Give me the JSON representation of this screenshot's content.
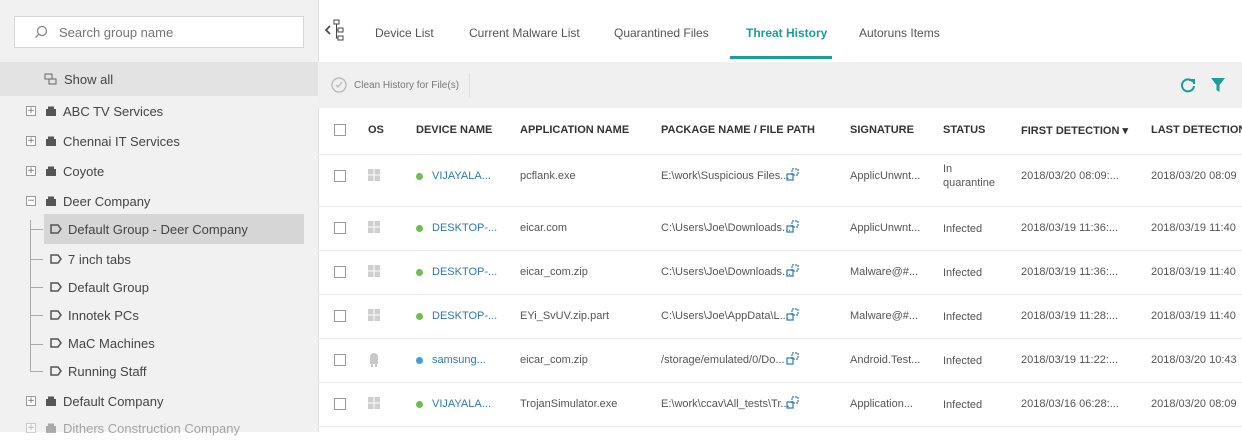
{
  "sidebar": {
    "search_placeholder": "Search group name",
    "show_all_label": "Show all",
    "groups": [
      {
        "label": "ABC TV Services",
        "expander": "+"
      },
      {
        "label": "Chennai IT Services",
        "expander": "+"
      },
      {
        "label": "Coyote",
        "expander": "+"
      },
      {
        "label": "Deer Company",
        "expander": "−"
      },
      {
        "label": "Default Company",
        "expander": "+"
      },
      {
        "label": "Dithers Construction Company",
        "expander": "+"
      }
    ],
    "subgroups": [
      {
        "label": "Default Group - Deer Company",
        "selected": true
      },
      {
        "label": "7 inch tabs"
      },
      {
        "label": "Default Group"
      },
      {
        "label": "Innotek PCs"
      },
      {
        "label": "MaC Machines"
      },
      {
        "label": "Running Staff"
      }
    ]
  },
  "tabs": [
    {
      "label": "Device List"
    },
    {
      "label": "Current Malware List"
    },
    {
      "label": "Quarantined Files"
    },
    {
      "label": "Threat History",
      "active": true
    },
    {
      "label": "Autoruns Items"
    }
  ],
  "toolbar": {
    "clean_history_label": "Clean History for File(s)"
  },
  "table": {
    "columns": [
      "OS",
      "DEVICE NAME",
      "APPLICATION NAME",
      "PACKAGE NAME / FILE PATH",
      "SIGNATURE",
      "STATUS",
      "FIRST DETECTION ▾",
      "LAST DETECTION"
    ],
    "rows": [
      {
        "os": "windows",
        "device": "VIJAYALA...",
        "app": "pcflank.exe",
        "path": "E:\\work\\Suspicious Files...",
        "signature": "ApplicUnwnt...",
        "status": "In quarantine",
        "first": "2018/03/20 08:09:...",
        "last": "2018/03/20 08:09"
      },
      {
        "os": "windows",
        "device": "DESKTOP-...",
        "app": "eicar.com",
        "path": "C:\\Users\\Joe\\Downloads...",
        "signature": "ApplicUnwnt...",
        "status": "Infected",
        "first": "2018/03/19 11:36:...",
        "last": "2018/03/19 11:40"
      },
      {
        "os": "windows",
        "device": "DESKTOP-...",
        "app": "eicar_com.zip",
        "path": "C:\\Users\\Joe\\Downloads...",
        "signature": "Malware@#...",
        "status": "Infected",
        "first": "2018/03/19 11:36:...",
        "last": "2018/03/19 11:40"
      },
      {
        "os": "windows",
        "device": "DESKTOP-...",
        "app": "EYi_SvUV.zip.part",
        "path": "C:\\Users\\Joe\\AppData\\L...",
        "signature": "Malware@#...",
        "status": "Infected",
        "first": "2018/03/19 11:28:...",
        "last": "2018/03/19 11:40"
      },
      {
        "os": "android",
        "device": "samsung...",
        "app": "eicar_com.zip",
        "path": "/storage/emulated/0/Do...",
        "signature": "Android.Test...",
        "status": "Infected",
        "first": "2018/03/19 11:22:...",
        "last": "2018/03/20 10:43"
      },
      {
        "os": "windows",
        "device": "VIJAYALA...",
        "app": "TrojanSimulator.exe",
        "path": "E:\\work\\ccav\\All_tests\\Tr...",
        "signature": "Application...",
        "status": "Infected",
        "first": "2018/03/16 06:28:...",
        "last": "2018/03/20 08:09"
      }
    ]
  },
  "colors": {
    "accent": "#1a9e96",
    "online_green": "#6cc04a",
    "online_blue": "#3aa0e0",
    "link": "#2a7ab8"
  }
}
